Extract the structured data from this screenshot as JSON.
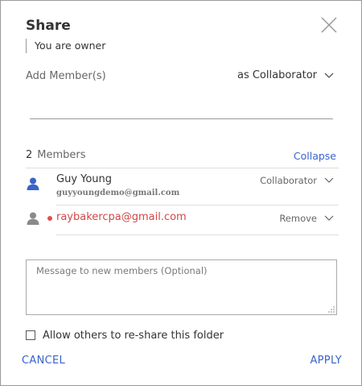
{
  "dialog": {
    "title": "Share",
    "owner_text": "You are owner"
  },
  "add_member": {
    "label": "Add Member(s)",
    "role": "as Collaborator",
    "input_value": ""
  },
  "members": {
    "count": "2",
    "label": "Members",
    "collapse_label": "Collapse",
    "list": [
      {
        "name": "Guy Young",
        "email": "guyyoungdemo@gmail.com",
        "role": "Collaborator",
        "icon": "user-icon"
      },
      {
        "email": "raybakercpa@gmail.com",
        "action": "Remove",
        "status": "pending",
        "icon": "user-pending-icon"
      }
    ]
  },
  "message": {
    "placeholder": "Message to new members (Optional)",
    "value": ""
  },
  "reshare": {
    "label": "Allow others to re-share this folder",
    "checked": false
  },
  "actions": {
    "cancel": "CANCEL",
    "apply": "APPLY"
  },
  "colors": {
    "accent": "#3a63c9",
    "pending_red": "#d04848",
    "user_blue": "#3a63c9",
    "user_gray": "#8a8a8a"
  }
}
